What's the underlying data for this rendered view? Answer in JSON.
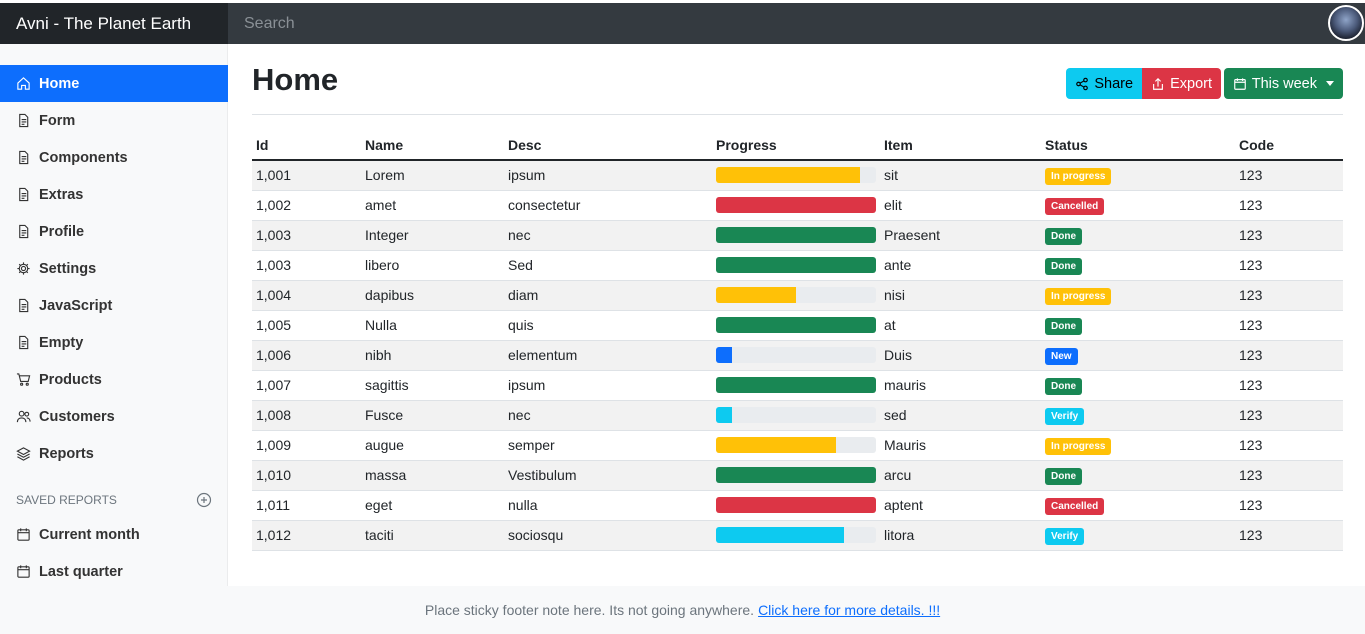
{
  "navbar": {
    "brand": "Avni - The Planet Earth",
    "search_placeholder": "Search"
  },
  "sidebar": {
    "items": [
      {
        "label": "Home",
        "icon": "home-icon"
      },
      {
        "label": "Form",
        "icon": "file-icon"
      },
      {
        "label": "Components",
        "icon": "file-icon"
      },
      {
        "label": "Extras",
        "icon": "file-icon"
      },
      {
        "label": "Profile",
        "icon": "file-icon"
      },
      {
        "label": "Settings",
        "icon": "gear-icon"
      },
      {
        "label": "JavaScript",
        "icon": "file-icon"
      },
      {
        "label": "Empty",
        "icon": "file-icon"
      },
      {
        "label": "Products",
        "icon": "cart-icon"
      },
      {
        "label": "Customers",
        "icon": "users-icon"
      },
      {
        "label": "Reports",
        "icon": "layers-icon"
      }
    ],
    "saved_reports_title": "SAVED REPORTS",
    "saved_reports": [
      {
        "label": "Current month",
        "icon": "calendar-icon"
      },
      {
        "label": "Last quarter",
        "icon": "calendar-icon"
      }
    ]
  },
  "main": {
    "title": "Home",
    "share_label": "Share",
    "export_label": "Export",
    "week_label": "This week",
    "columns": [
      "Id",
      "Name",
      "Desc",
      "Progress",
      "Item",
      "Status",
      "Code"
    ],
    "rows": [
      {
        "id": "1,001",
        "name": "Lorem",
        "desc": "ipsum",
        "progress": 90,
        "color": "#ffc107",
        "item": "sit",
        "status": "In progress",
        "status_bg": "#ffc107",
        "status_fg": "#ffffff",
        "code": "123"
      },
      {
        "id": "1,002",
        "name": "amet",
        "desc": "consectetur",
        "progress": 100,
        "color": "#dc3545",
        "item": "elit",
        "status": "Cancelled",
        "status_bg": "#dc3545",
        "status_fg": "#ffffff",
        "code": "123"
      },
      {
        "id": "1,003",
        "name": "Integer",
        "desc": "nec",
        "progress": 100,
        "color": "#198754",
        "item": "Praesent",
        "status": "Done",
        "status_bg": "#198754",
        "status_fg": "#ffffff",
        "code": "123"
      },
      {
        "id": "1,003",
        "name": "libero",
        "desc": "Sed",
        "progress": 100,
        "color": "#198754",
        "item": "ante",
        "status": "Done",
        "status_bg": "#198754",
        "status_fg": "#ffffff",
        "code": "123"
      },
      {
        "id": "1,004",
        "name": "dapibus",
        "desc": "diam",
        "progress": 50,
        "color": "#ffc107",
        "item": "nisi",
        "status": "In progress",
        "status_bg": "#ffc107",
        "status_fg": "#ffffff",
        "code": "123"
      },
      {
        "id": "1,005",
        "name": "Nulla",
        "desc": "quis",
        "progress": 100,
        "color": "#198754",
        "item": "at",
        "status": "Done",
        "status_bg": "#198754",
        "status_fg": "#ffffff",
        "code": "123"
      },
      {
        "id": "1,006",
        "name": "nibh",
        "desc": "elementum",
        "progress": 10,
        "color": "#0d6efd",
        "item": "Duis",
        "status": "New",
        "status_bg": "#0d6efd",
        "status_fg": "#ffffff",
        "code": "123"
      },
      {
        "id": "1,007",
        "name": "sagittis",
        "desc": "ipsum",
        "progress": 100,
        "color": "#198754",
        "item": "mauris",
        "status": "Done",
        "status_bg": "#198754",
        "status_fg": "#ffffff",
        "code": "123"
      },
      {
        "id": "1,008",
        "name": "Fusce",
        "desc": "nec",
        "progress": 10,
        "color": "#0dcaf0",
        "item": "sed",
        "status": "Verify",
        "status_bg": "#0dcaf0",
        "status_fg": "#ffffff",
        "code": "123"
      },
      {
        "id": "1,009",
        "name": "augue",
        "desc": "semper",
        "progress": 75,
        "color": "#ffc107",
        "item": "Mauris",
        "status": "In progress",
        "status_bg": "#ffc107",
        "status_fg": "#ffffff",
        "code": "123"
      },
      {
        "id": "1,010",
        "name": "massa",
        "desc": "Vestibulum",
        "progress": 100,
        "color": "#198754",
        "item": "arcu",
        "status": "Done",
        "status_bg": "#198754",
        "status_fg": "#ffffff",
        "code": "123"
      },
      {
        "id": "1,011",
        "name": "eget",
        "desc": "nulla",
        "progress": 100,
        "color": "#dc3545",
        "item": "aptent",
        "status": "Cancelled",
        "status_bg": "#dc3545",
        "status_fg": "#ffffff",
        "code": "123"
      },
      {
        "id": "1,012",
        "name": "taciti",
        "desc": "sociosqu",
        "progress": 80,
        "color": "#0dcaf0",
        "item": "litora",
        "status": "Verify",
        "status_bg": "#0dcaf0",
        "status_fg": "#ffffff",
        "code": "123"
      }
    ]
  },
  "footer": {
    "text": "Place sticky footer note here. Its not going anywhere.",
    "link": "Click here for more details. !!!"
  }
}
